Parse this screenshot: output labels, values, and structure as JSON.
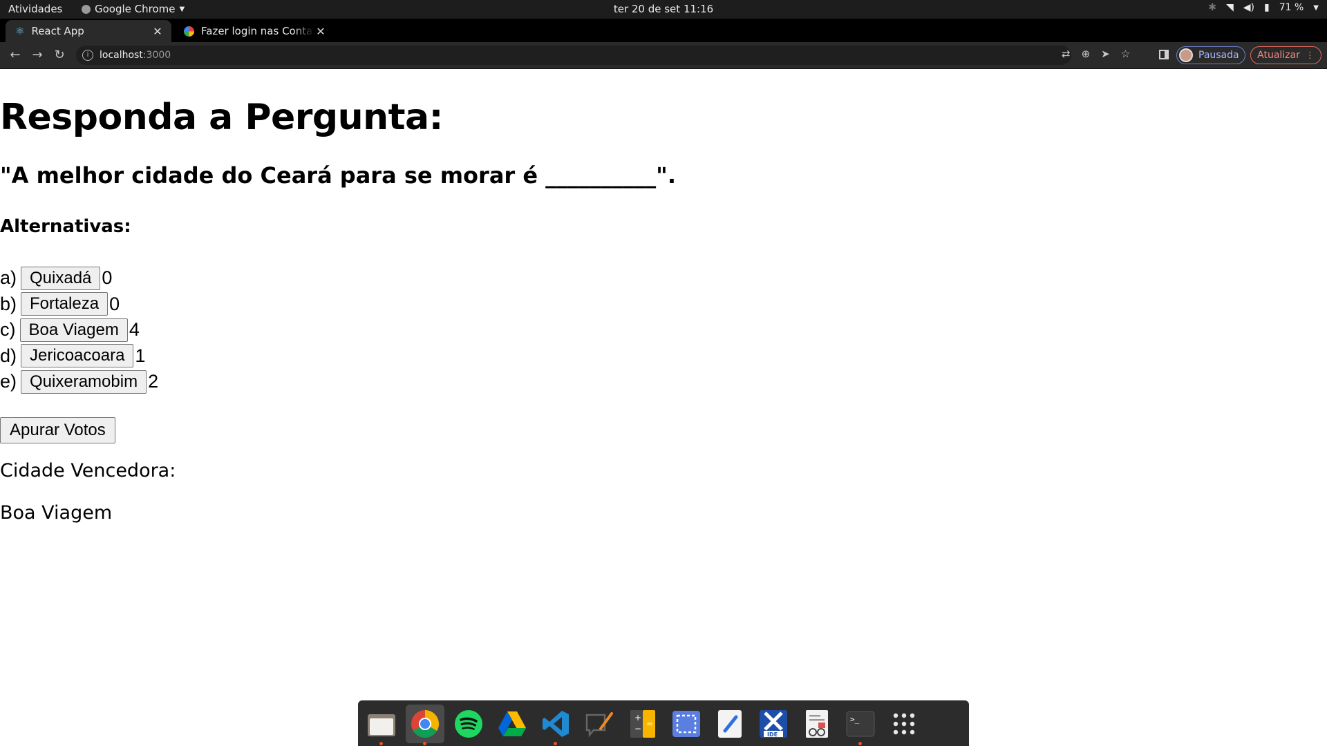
{
  "system_bar": {
    "activities": "Atividades",
    "app_menu": "Google Chrome",
    "clock": "ter 20 de set  11:16",
    "battery": "71 %"
  },
  "browser": {
    "tabs": [
      {
        "title": "React App",
        "active": true
      },
      {
        "title": "Fazer login nas Contas do Google",
        "active": false
      }
    ],
    "url_host": "localhost",
    "url_port": ":3000",
    "profile_label": "Pausada",
    "update_label": "Atualizar"
  },
  "page": {
    "heading": "Responda a Pergunta:",
    "question": "\"A melhor cidade do Ceará para se morar é __________\".",
    "alternatives_title": "Alternativas:",
    "options": [
      {
        "letter": "a)",
        "city": "Quixadá",
        "votes": "0"
      },
      {
        "letter": "b)",
        "city": "Fortaleza",
        "votes": "0"
      },
      {
        "letter": "c)",
        "city": "Boa Viagem",
        "votes": "4"
      },
      {
        "letter": "d)",
        "city": "Jericoacoara",
        "votes": "1"
      },
      {
        "letter": "e)",
        "city": "Quixeramobim",
        "votes": "2"
      }
    ],
    "tally_button": "Apurar Votos",
    "winner_label": "Cidade Vencedora:",
    "winner": "Boa Viagem"
  },
  "colors": {
    "accent_profile": "#a8b8ff",
    "accent_update": "#f28b82",
    "dock_indicator": "#e95420"
  },
  "dock_apps": [
    "files-icon",
    "chrome-icon",
    "spotify-icon",
    "google-drive-icon",
    "vscode-icon",
    "feedback-icon",
    "calculator-icon",
    "screenshot-icon",
    "text-editor-icon",
    "xampp-ide-icon",
    "document-viewer-icon",
    "terminal-icon",
    "app-grid-icon"
  ]
}
